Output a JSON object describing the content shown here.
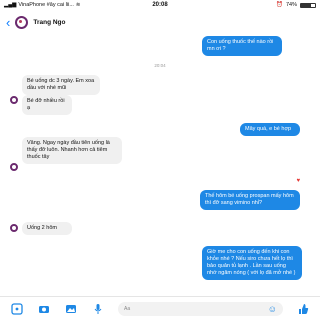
{
  "status": {
    "carrier": "VinaPhone #ây cai lii...",
    "time": "20:08",
    "battery": "74%"
  },
  "header": {
    "back_icon": "chevron-left-icon",
    "contact_name": "Trang Ngo"
  },
  "messages": [
    {
      "dir": "out",
      "text": "Con uống thuốc thế nào rồi mn ơi ?"
    },
    {
      "dir": "ts",
      "text": "20:04"
    },
    {
      "dir": "in",
      "text": "Bé uống dc 3 ngày. Em xoa dầu với nhé mũi"
    },
    {
      "dir": "in",
      "text": "Bé đỡ nhiều rồi ạ"
    },
    {
      "dir": "out",
      "text": "Mây quá, e bé hợp"
    },
    {
      "dir": "in",
      "text": "Vâng. Ngay ngày đầu tiên uống là thấy đỡ luôn. Nhanh hơn cả tiêm thuốc tây"
    },
    {
      "dir": "out",
      "text": "Thế hôm bé uống prospan mấy hôm thì đỡ sang vimino nhỉ?"
    },
    {
      "dir": "in",
      "text": "Uống 2 hôm"
    },
    {
      "dir": "out",
      "text": "Giờ me cho con uống đến khi con khỏe nhé ? Nếu siro chưa hết lọ thì bảo quản tủ lạnh . Lần sau uống nhớ ngâm nóng ( với lọ đã mở nhé )"
    }
  ],
  "reaction": "♥",
  "composer": {
    "placeholder": "Aa"
  }
}
